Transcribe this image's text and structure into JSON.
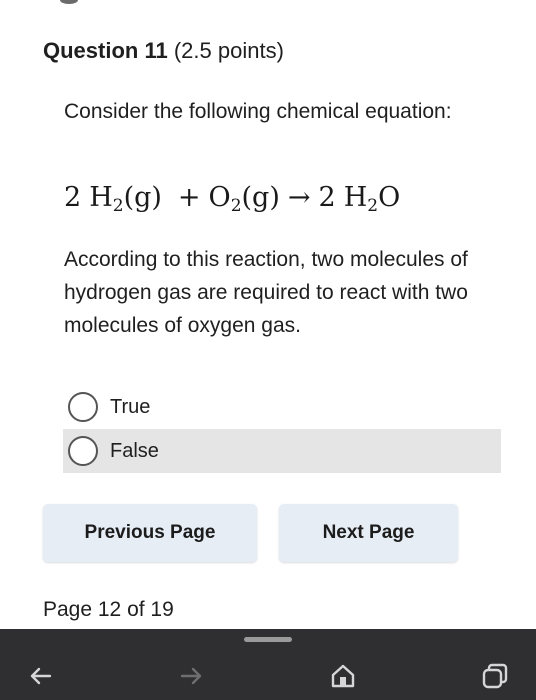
{
  "question": {
    "number_label": "Question 11",
    "points_label": "(2.5 points)",
    "prompt": "Consider the following chemical equation:",
    "equation": {
      "coef1": "2",
      "h": "H",
      "sub2a": "2",
      "g1": "(g)",
      "plus": "+",
      "o": "O",
      "sub2b": "2",
      "g2": "(g)",
      "arrow": "→",
      "coef2": "2",
      "h2": "H",
      "sub2c": "2",
      "o2": "O"
    },
    "statement": "According to this reaction, two molecules of hydrogen gas are required to react with two molecules of oxygen gas.",
    "options": [
      {
        "label": "True",
        "selected": false
      },
      {
        "label": "False",
        "selected": false,
        "highlighted": true
      }
    ]
  },
  "navigation": {
    "previous_label": "Previous Page",
    "next_label": "Next Page",
    "page_indicator": "Page 12 of 19"
  },
  "browser_bar": {
    "icons": [
      "back-arrow-icon",
      "forward-arrow-icon",
      "home-icon",
      "tabs-icon"
    ],
    "background": "#2f2f31"
  },
  "colors": {
    "button_bg": "#e7edf5",
    "highlight_bg": "#e5e5e5",
    "text": "#1f1f1f"
  }
}
